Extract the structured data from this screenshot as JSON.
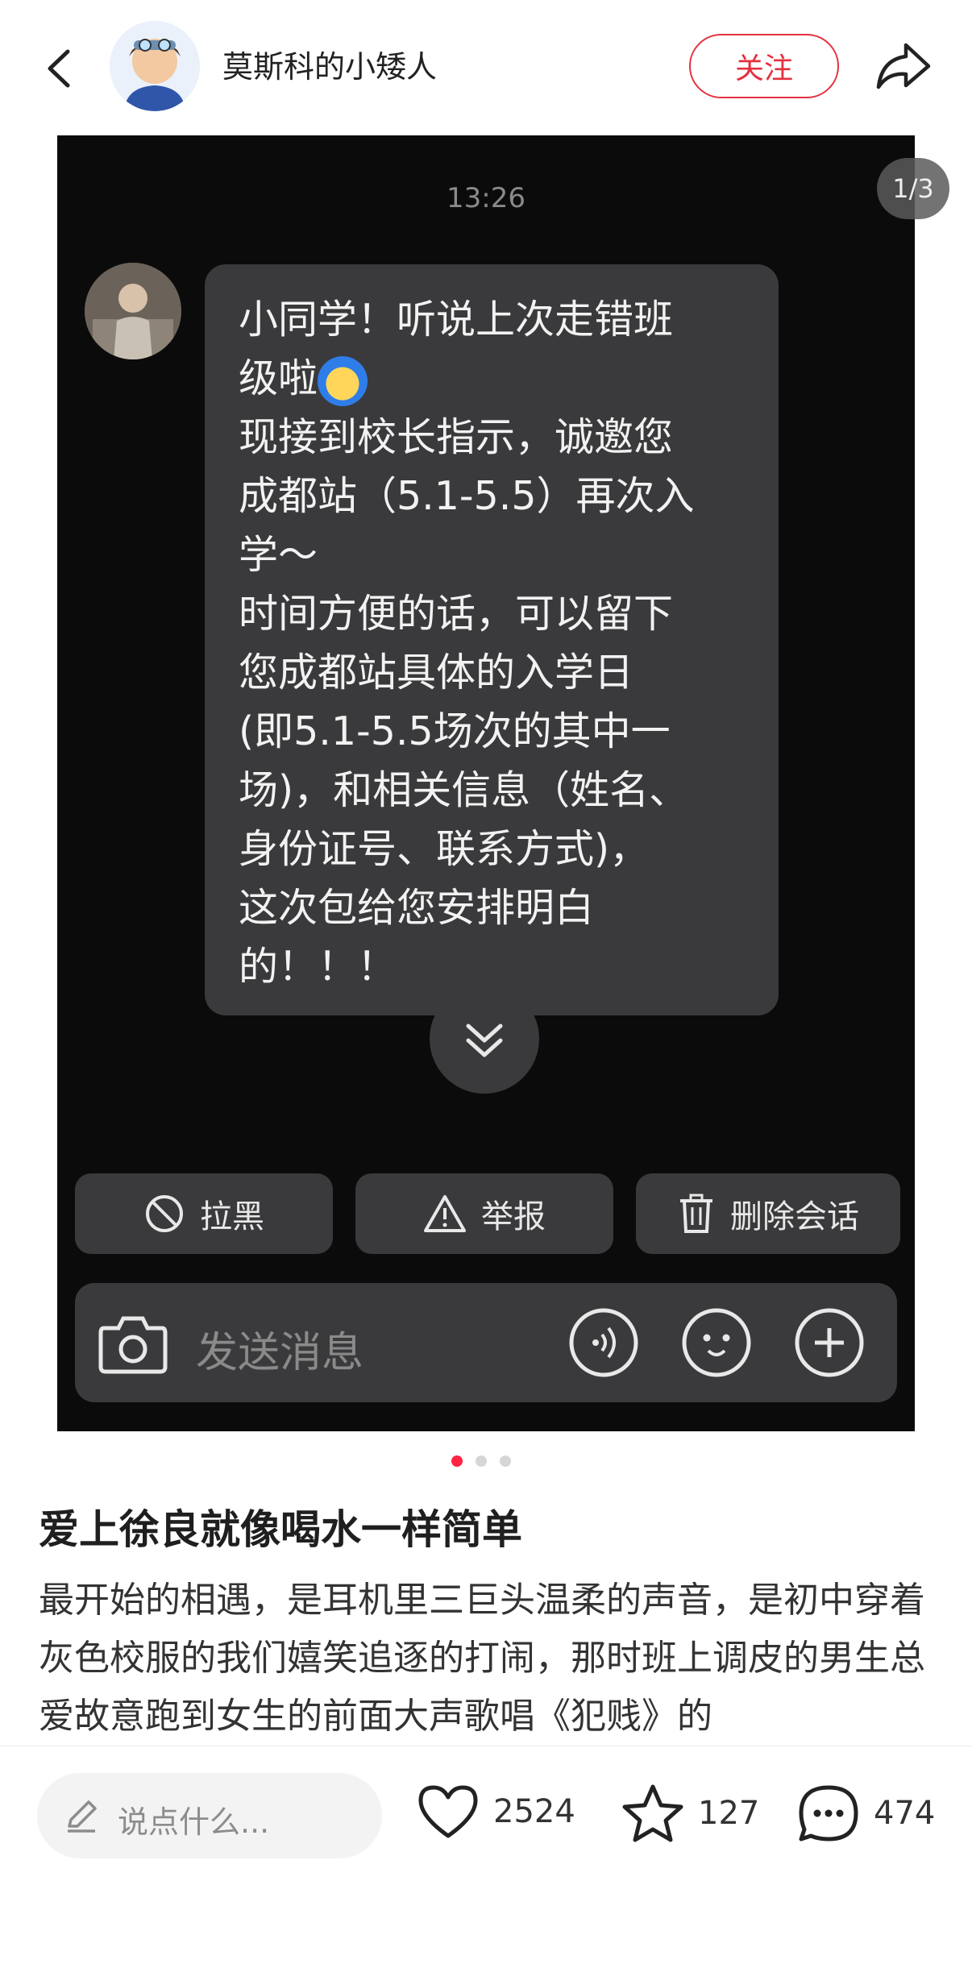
{
  "header": {
    "username": "莫斯科的小矮人",
    "follow_label": "关注"
  },
  "carousel": {
    "counter": "1/3",
    "current_index": 1,
    "total": 3
  },
  "chat": {
    "time": "13:26",
    "message_lines": [
      "小同学！听说上次走错班",
      "级啦",
      "现接到校长指示，诚邀您",
      "成都站（5.1-5.5）再次入",
      "学～",
      "时间方便的话，可以留下",
      "您成都站具体的入学日",
      "(即5.1-5.5场次的其中一",
      "场)，和相关信息（姓名、",
      "身份证号、联系方式)，",
      "这次包给您安排明白",
      "的！！！"
    ],
    "actions": {
      "block": "拉黑",
      "report": "举报",
      "delete": "删除会话"
    },
    "input_placeholder": "发送消息"
  },
  "post": {
    "title": "爱上徐良就像喝水一样简单",
    "content": "最开始的相遇，是耳机里三巨头温柔的声音，是初中穿着灰色校服的我们嬉笑追逐的打闹，那时班上调皮的男生总爱故意跑到女生的前面大声歌唱《犯贱》的"
  },
  "bottom_bar": {
    "comment_placeholder": "说点什么...",
    "likes": "2524",
    "favorites": "127",
    "comments": "474"
  },
  "colors": {
    "accent": "#e4303f",
    "dot_active": "#ff2442",
    "chat_bg": "#0b0b0b",
    "bubble": "#3a3a3c"
  },
  "icons": [
    "back-icon",
    "share-icon",
    "block-icon",
    "warning-icon",
    "trash-icon",
    "camera-icon",
    "voice-icon",
    "emoji-icon",
    "plus-icon",
    "chevron-double-down-icon",
    "pencil-icon",
    "heart-icon",
    "star-icon",
    "comment-icon"
  ]
}
